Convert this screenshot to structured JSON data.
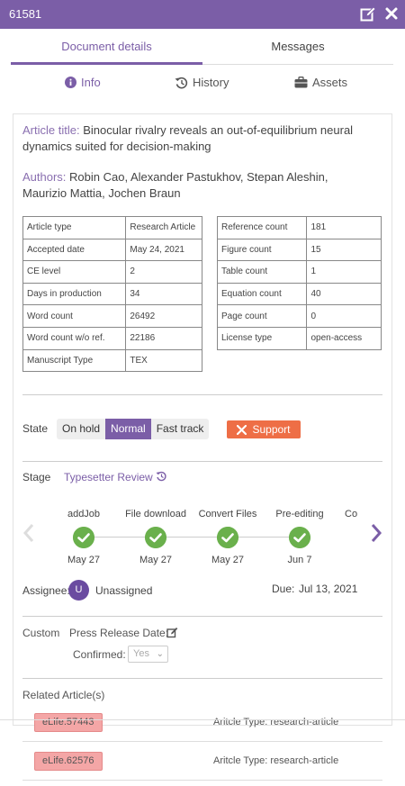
{
  "window": {
    "title": "61581"
  },
  "tabs": [
    "Document details",
    "Messages"
  ],
  "subtabs": {
    "info": "Info",
    "history": "History",
    "assets": "Assets"
  },
  "article": {
    "title_label": "Article title:",
    "title": "Binocular rivalry reveals an out-of-equilibrium neural dynamics suited for decision-making",
    "authors_label": "Authors:",
    "authors": "Robin Cao, Alexander Pastukhov, Stepan Aleshin, Maurizio Mattia, Jochen Braun"
  },
  "meta_left": [
    {
      "label": "Article type",
      "value": "Research Article"
    },
    {
      "label": "Accepted date",
      "value": "May 24, 2021"
    },
    {
      "label": "CE level",
      "value": "2"
    },
    {
      "label": "Days in production",
      "value": "34"
    },
    {
      "label": "Word count",
      "value": "26492"
    },
    {
      "label": "Word count w/o ref.",
      "value": "22186"
    },
    {
      "label": "Manuscript Type",
      "value": "TEX"
    }
  ],
  "meta_right": [
    {
      "label": "Reference count",
      "value": "181"
    },
    {
      "label": "Figure count",
      "value": "15"
    },
    {
      "label": "Table count",
      "value": "1"
    },
    {
      "label": "Equation count",
      "value": "40"
    },
    {
      "label": "Page count",
      "value": "0"
    },
    {
      "label": "License type",
      "value": "open-access"
    }
  ],
  "state": {
    "label": "State",
    "options": [
      "On hold",
      "Normal",
      "Fast track"
    ],
    "selected": "Normal",
    "support_label": "Support"
  },
  "stage": {
    "label": "Stage",
    "value": "Typesetter Review",
    "steps": [
      {
        "name": "addJob",
        "date": "May 27"
      },
      {
        "name": "File download",
        "date": "May 27"
      },
      {
        "name": "Convert Files",
        "date": "May 27"
      },
      {
        "name": "Pre-editing",
        "date": "Jun 7"
      },
      {
        "name": "Co",
        "date": ""
      }
    ]
  },
  "assignee": {
    "label": "Assignee:",
    "initial": "U",
    "value": "Unassigned",
    "due_label": "Due:",
    "due_value": "Jul 13, 2021"
  },
  "custom": {
    "label": "Custom",
    "press_release_label": "Press Release Date:",
    "confirmed_label": "Confirmed:",
    "confirmed_value": "Yes"
  },
  "related": {
    "label": "Related Article(s)",
    "items": [
      {
        "id": "eLife.57443",
        "type": "Aritcle Type: research-article"
      },
      {
        "id": "eLife.62576",
        "type": "Aritcle Type: research-article"
      }
    ]
  },
  "colors": {
    "accent": "#7b5ea7",
    "support": "#ee6e46",
    "check": "#6ab04c",
    "tag": "#f4a6a6"
  }
}
